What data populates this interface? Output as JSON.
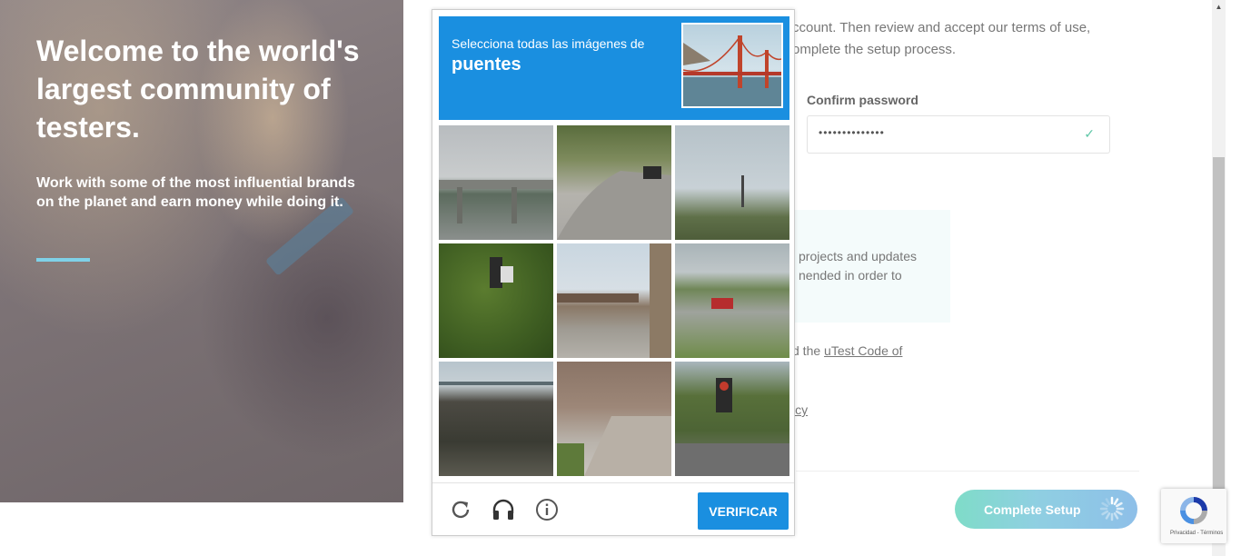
{
  "hero": {
    "title": "Welcome to the world's largest community of testers.",
    "subtitle": "Work with some of the most influential brands on the planet and earn money while doing it."
  },
  "form": {
    "intro_line1": "ccount. Then review and accept our terms of use,",
    "intro_line2": "omplete the setup process.",
    "confirm_label": "Confirm password",
    "confirm_value": "••••••••••••••",
    "info_line1": " projects and updates",
    "info_line2": "nended in order to",
    "code_prefix": "d the ",
    "code_link": "uTest Code of",
    "policy_link": "icy",
    "complete_button": "Complete Setup"
  },
  "captcha": {
    "instruction": "Selecciona todas las imágenes de",
    "target": "puentes",
    "verify_button": "VERIFICAR",
    "tiles": [
      "bridge-overpass",
      "curved-road-car",
      "trees-tower",
      "traffic-light-foliage",
      "building-canopy",
      "highway-red-car",
      "bridge-railing",
      "stairs-house",
      "traffic-light-cars"
    ]
  },
  "badge": {
    "links": "Privacidad - Términos"
  },
  "colors": {
    "captcha_blue": "#1a8fe0",
    "accent_teal": "#7fdcc8",
    "hero_bar": "#7fd1e8"
  },
  "icons": [
    "reload-icon",
    "headphones-icon",
    "info-icon",
    "check-icon",
    "recaptcha-logo-icon",
    "spinner-icon"
  ]
}
